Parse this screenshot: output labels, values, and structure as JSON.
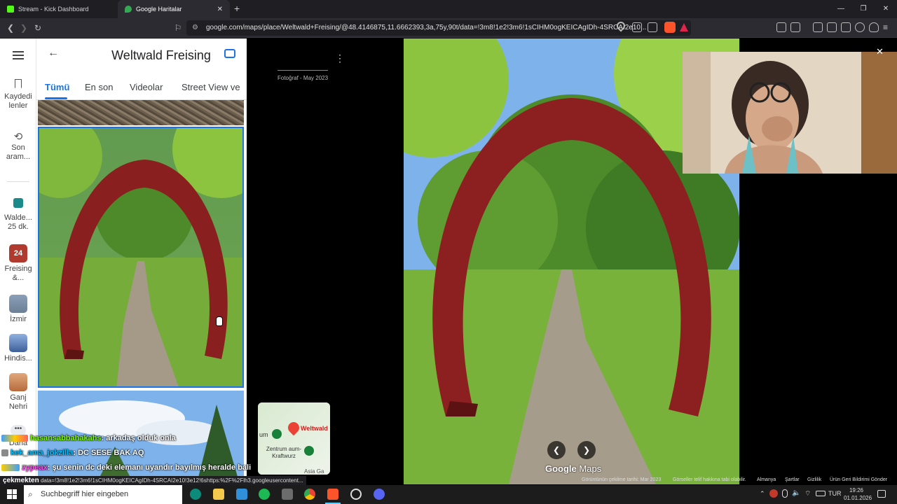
{
  "browser": {
    "tabs": [
      {
        "title": "Stream - Kick Dashboard",
        "active": false,
        "favicon_color": "#53fc18"
      },
      {
        "title": "Google Haritalar",
        "active": true,
        "favicon_color": "#34a853"
      }
    ],
    "new_tab": "+",
    "url": "google.com/maps/place/Weltwald+Freising/@48.4146875,11.6662393,3a,75y,90t/data=!3m8!1e2!3m6!1sCIHM0ogKEICAgIDh-4SRCAI2e10..."
  },
  "maps": {
    "place_title": "Weltwald Freising",
    "tabs": [
      "Tümü",
      "En son",
      "Videolar",
      "Street View ve"
    ],
    "active_tab": "Tümü",
    "rail": [
      {
        "label": "Kaydedi lenler",
        "icon": "bookmark-icon"
      },
      {
        "label": "Son aram...",
        "icon": "history-icon"
      },
      {
        "label": "Walde... 25 dk.",
        "icon": "transit-icon"
      },
      {
        "label": "Freising &...",
        "icon": "calendar-icon",
        "badge": "24"
      },
      {
        "label": "İzmir",
        "icon": "place-thumb"
      },
      {
        "label": "Hindis...",
        "icon": "place-thumb"
      },
      {
        "label": "Ganj Nehri",
        "icon": "place-thumb"
      },
      {
        "label": "Daha",
        "icon": "more-icon"
      }
    ],
    "photo_caption": "Fotoğraf - May 2023",
    "minimap": {
      "pin_label": "Weltwald",
      "label_left": "um",
      "label_bottom": "Zentrum aum-Kraftwurz",
      "label_corner": "Asia Ga"
    },
    "logo": {
      "google": "Google",
      "maps": "Maps"
    },
    "footer": [
      "Görüntünün çekilme tarihi: Mar 2023",
      "Görseller telif hakkına tabi olabilir.",
      "Almanya",
      "Şartlar",
      "Gizlilik",
      "Ürün Geri Bildirimi Gönder"
    ],
    "status_url": "data=!3m8!1e2!3m6!1sCIHM0ogKEICAgIDh-4SRCAI2e10!3e12!6shttps:%2F%2Flh3.googleusercontent..."
  },
  "chat": [
    {
      "user": "hasansabbahakahs",
      "message": ": arkadaş olduk onla",
      "user_color": "#7cfc00"
    },
    {
      "user": "kek_ama_jokzilla",
      "message": ": DC SESE BAK AQ",
      "user_color": "#00bfff"
    },
    {
      "user": "zypeax",
      "message": ": şu senin dc deki elemanı uyandır bayılmış heralde bali",
      "user_color": "#ff4df0"
    }
  ],
  "chat_cut_label": "çekmekten",
  "taskbar": {
    "search_placeholder": "Suchbegriff hier eingeben",
    "lang": "TUR",
    "time": "19:26",
    "date": "01.01.2026"
  }
}
